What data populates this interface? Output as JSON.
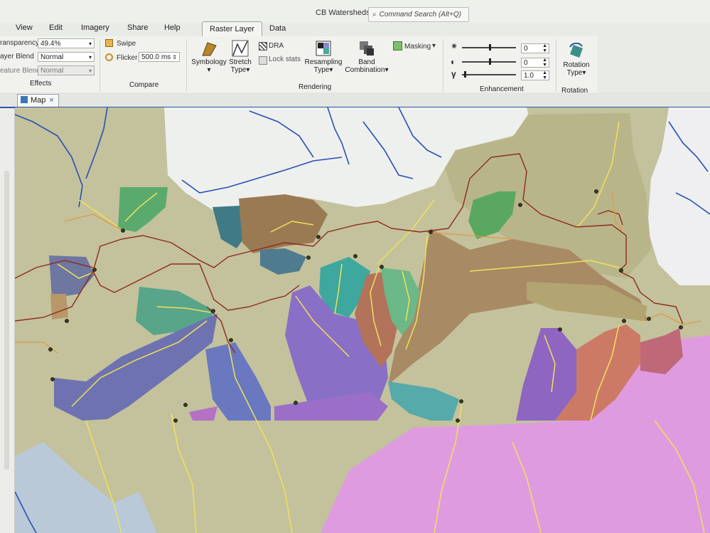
{
  "window": {
    "title": "CB Watersheds",
    "search_placeholder": "Command Search (Alt+Q)"
  },
  "menu": [
    "View",
    "Edit",
    "Imagery",
    "Share",
    "Help"
  ],
  "context_tabs": [
    "Raster Layer",
    "Data"
  ],
  "effects": {
    "transparency_label": "ransparency",
    "transparency_value": "49.4%",
    "layer_blend_label": "ayer Blend",
    "layer_blend_value": "Normal",
    "feature_blend_label": "eature Blend",
    "feature_blend_value": "Normal",
    "group_label": "Effects"
  },
  "compare": {
    "swipe_label": "Swipe",
    "flicker_label": "Flicker",
    "flicker_value": "500.0",
    "flicker_unit": "ms",
    "group_label": "Compare"
  },
  "rendering": {
    "symbology_label": "Symbology",
    "stretch_label_1": "Stretch",
    "stretch_label_2": "Type",
    "dra_label": "DRA",
    "lock_stats_label": "Lock stats",
    "resampling_label_1": "Resampling",
    "resampling_label_2": "Type",
    "band_label_1": "Band",
    "band_label_2": "Combination",
    "masking_label": "Masking",
    "group_label": "Rendering"
  },
  "enhancement": {
    "brightness_value": "0",
    "contrast_value": "0",
    "gamma_symbol": "γ",
    "gamma_value": "1.0",
    "brightness_level": 0,
    "contrast_level": 0,
    "gamma_level": 1.0,
    "group_label": "Enhancement"
  },
  "rotation": {
    "label_1": "Rotation",
    "label_2": "Type",
    "group_label": "Rotation"
  },
  "map_view": {
    "tab_label": "Map",
    "close_glyph": "×"
  },
  "colors": {
    "terrain": "#c3c29c",
    "river_blue": "#2a4fb5",
    "stream_yellow": "#efe25a",
    "road_brown": "#8c2a1c",
    "accent_blue": "#2b55a8"
  },
  "icons": {
    "search": "search-icon",
    "swipe": "swipe-icon",
    "flicker": "flicker-icon",
    "symbology": "symbology-icon",
    "stretch": "stretch-icon",
    "dra": "dra-icon",
    "resampling": "resampling-icon",
    "band": "band-combination-icon",
    "masking": "masking-icon",
    "brightness": "brightness-icon",
    "contrast": "contrast-icon",
    "rotation": "rotation-icon",
    "map": "map-icon"
  }
}
